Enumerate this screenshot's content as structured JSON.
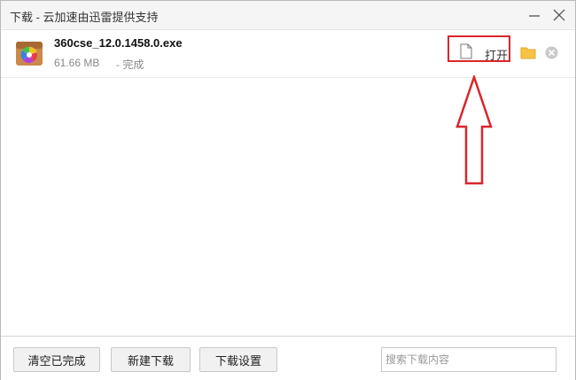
{
  "window": {
    "title": "下载 - 云加速由迅雷提供支持",
    "minimize_icon": "minimize-icon",
    "close_icon": "close-icon"
  },
  "downloads": [
    {
      "file_name": "360cse_12.0.1458.0.exe",
      "size": "61.66 MB",
      "status": "- 完成",
      "icon": "installer-icon",
      "open_label": "打开",
      "open_icon": "document-icon",
      "folder_icon": "folder-icon",
      "remove_icon": "remove-icon"
    }
  ],
  "annotation": {
    "color": "#d9262c",
    "shape": "up-arrow"
  },
  "footer": {
    "clear_label": "清空已完成",
    "new_label": "新建下载",
    "settings_label": "下载设置",
    "search_placeholder": "搜索下载内容"
  }
}
